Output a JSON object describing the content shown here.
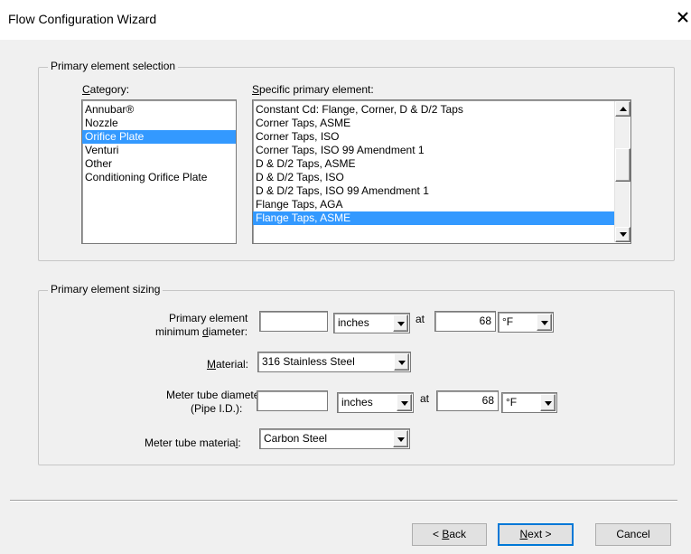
{
  "window": {
    "title": "Flow Configuration Wizard",
    "close_glyph": "✕"
  },
  "selection_group": {
    "legend": "Primary element selection",
    "category_label": "Category:",
    "specific_label": "Specific primary element:",
    "categories": [
      "Annubar®",
      "Nozzle",
      "Orifice Plate",
      "Venturi",
      "Other",
      "Conditioning Orifice Plate"
    ],
    "selected_category": "Orifice Plate",
    "specific_items": [
      "Constant Cd: Flange, Corner, D & D/2 Taps",
      "Corner Taps, ASME",
      "Corner Taps, ISO",
      "Corner Taps, ISO 99 Amendment 1",
      "D & D/2 Taps, ASME",
      "D & D/2 Taps, ISO",
      "D & D/2 Taps, ISO 99 Amendment 1",
      "Flange Taps, AGA",
      "Flange Taps, ASME"
    ],
    "selected_specific": "Flange Taps, ASME"
  },
  "sizing_group": {
    "legend": "Primary element sizing",
    "min_diameter_label_1": "Primary element",
    "min_diameter_label_2": "minimum diameter:",
    "min_diameter_value": "",
    "min_diameter_unit": "inches",
    "at_label": "at",
    "min_diameter_temp": "68",
    "min_diameter_temp_unit": "°F",
    "material_label": "Material:",
    "material_value": "316 Stainless Steel",
    "meter_tube_label_1": "Meter tube diameter",
    "meter_tube_label_2": "(Pipe I.D.):",
    "meter_tube_value": "",
    "meter_tube_unit": "inches",
    "meter_tube_temp": "68",
    "meter_tube_temp_unit": "°F",
    "meter_tube_material_label": "Meter tube material:",
    "meter_tube_material_value": "Carbon Steel"
  },
  "buttons": {
    "back": "< Back",
    "next": "Next >",
    "cancel": "Cancel"
  },
  "colors": {
    "selection": "#3399ff",
    "background": "#f0f0f0",
    "default_button_border": "#0078d7"
  }
}
